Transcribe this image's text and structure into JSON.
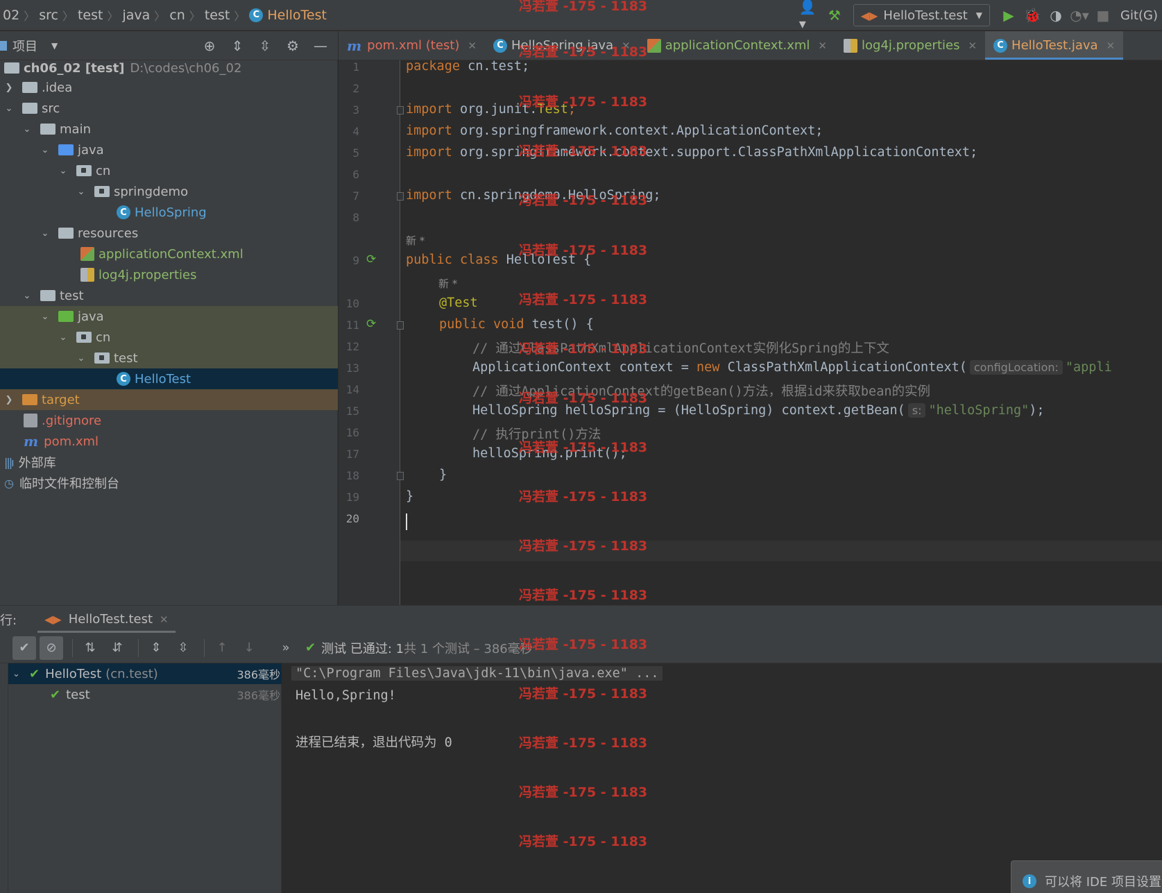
{
  "breadcrumbs": [
    "02",
    "src",
    "test",
    "java",
    "cn",
    "test",
    "HelloTest"
  ],
  "toolbar": {
    "run_config": "HelloTest.test",
    "git": "Git(G)"
  },
  "project_panel": {
    "title": "项目"
  },
  "tree": [
    {
      "label": "ch06_02 [test]",
      "path": "D:\\codes\\ch06_02"
    },
    {
      "label": ".idea"
    },
    {
      "label": "src"
    },
    {
      "label": "main"
    },
    {
      "label": "java"
    },
    {
      "label": "cn"
    },
    {
      "label": "springdemo"
    },
    {
      "label": "HelloSpring"
    },
    {
      "label": "resources"
    },
    {
      "label": "applicationContext.xml"
    },
    {
      "label": "log4j.properties"
    },
    {
      "label": "test"
    },
    {
      "label": "java"
    },
    {
      "label": "cn"
    },
    {
      "label": "test"
    },
    {
      "label": "HelloTest"
    },
    {
      "label": "target"
    },
    {
      "label": ".gitignore"
    },
    {
      "label": "pom.xml"
    },
    {
      "label": "外部库"
    },
    {
      "label": "临时文件和控制台"
    }
  ],
  "tabs": [
    {
      "label": "pom.xml (test)"
    },
    {
      "label": "HelloSpring.java"
    },
    {
      "label": "applicationContext.xml"
    },
    {
      "label": "log4j.properties"
    },
    {
      "label": "HelloTest.java"
    }
  ],
  "editor": {
    "line_numbers": [
      "1",
      "2",
      "3",
      "4",
      "5",
      "6",
      "7",
      "8",
      "9",
      "10",
      "11",
      "12",
      "13",
      "14",
      "15",
      "16",
      "17",
      "18",
      "19",
      "20"
    ],
    "usage_hint": "新 *",
    "param_hint_1": "configLocation:",
    "param_hint_2": "s:",
    "lines": {
      "l1_kw": "package",
      "l1_rest": " cn.test;",
      "l3_kw": "import",
      "l3_rest": " org.junit.",
      "l3_ann": "Test",
      "l3_end": ";",
      "l4_kw": "import",
      "l4_rest": " org.springframework.context.ApplicationContext;",
      "l5_kw": "import",
      "l5_rest": " org.springframework.context.support.ClassPathXmlApplicationContext;",
      "l7_kw": "import",
      "l7_rest": " cn.springdemo.HelloSpring;",
      "l9_kw": "public class",
      "l9_rest": " HelloTest {",
      "l10": "@Test",
      "l11_kw": "public void",
      "l11_rest": " test() {",
      "l12": "// 通过ClassPathXmlApplicationContext实例化Spring的上下文",
      "l13_a": "ApplicationContext context = ",
      "l13_kw": "new",
      "l13_b": " ClassPathXmlApplicationContext(",
      "l13_str": "\"appli",
      "l14": "// 通过ApplicationContext的getBean()方法，根据id来获取bean的实例",
      "l15_a": "HelloSpring helloSpring = (HelloSpring) context.getBean(",
      "l15_str": "\"helloSpring\"",
      "l15_end": ");",
      "l16": "// 执行print()方法",
      "l17": "helloSpring.print();",
      "l18": "}",
      "l19": "}"
    }
  },
  "watermark": "冯若萱 -175 - 1183",
  "run_panel": {
    "label": "行:",
    "tab": "HelloTest.test",
    "status_passed": "测试 已通过: 1",
    "status_detail": "共 1 个测试 – 386毫秒",
    "tests": [
      {
        "name": "HelloTest",
        "pkg": "(cn.test)",
        "time": "386毫秒"
      },
      {
        "name": "test",
        "time": "386毫秒"
      }
    ],
    "console": [
      "\"C:\\Program Files\\Java\\jdk-11\\bin\\java.exe\" ...",
      "Hello,Spring!",
      "",
      "进程已结束，退出代码为 0"
    ]
  },
  "notification": "可以将 IDE 项目设置..."
}
